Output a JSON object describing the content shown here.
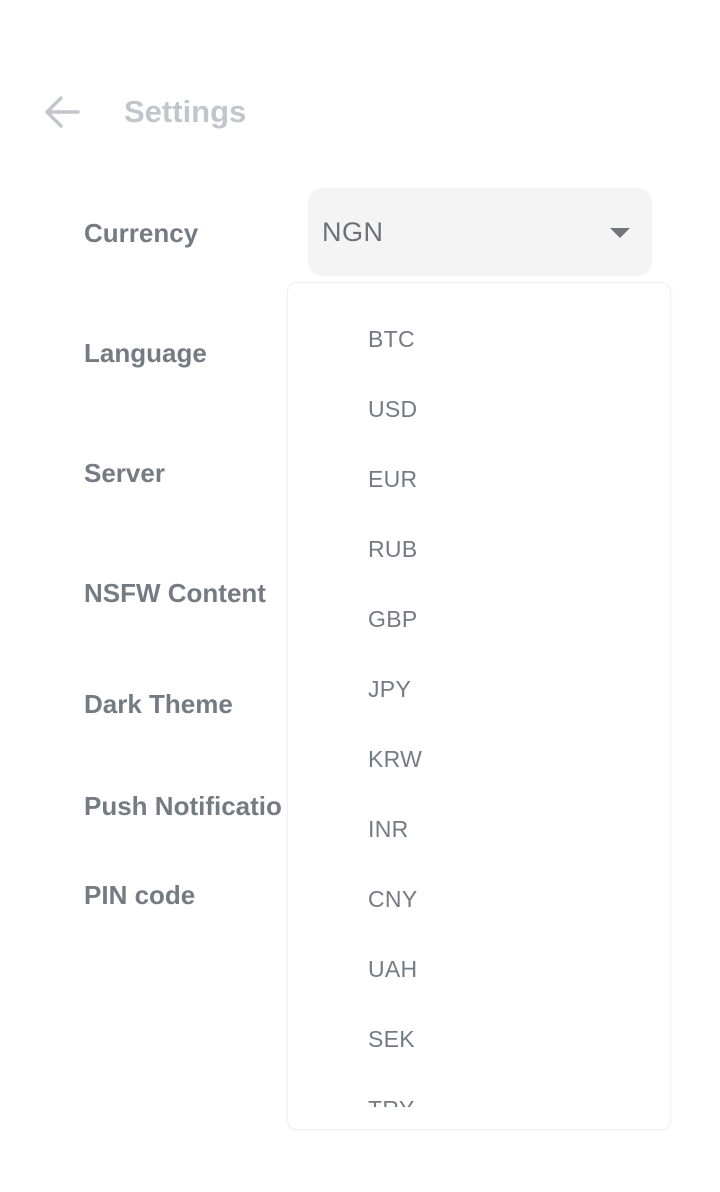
{
  "header": {
    "title": "Settings",
    "back_icon": "arrow-left-icon"
  },
  "settings": {
    "rows": [
      {
        "label": "Currency"
      },
      {
        "label": "Language"
      },
      {
        "label": "Server"
      },
      {
        "label": "NSFW Content"
      },
      {
        "label": "Dark Theme"
      },
      {
        "label": "Push Notificatio"
      },
      {
        "label": "PIN code"
      }
    ]
  },
  "currency_select": {
    "value": "NGN",
    "caret_icon": "caret-down-icon",
    "options": [
      "BTC",
      "USD",
      "EUR",
      "RUB",
      "GBP",
      "JPY",
      "KRW",
      "INR",
      "CNY",
      "UAH",
      "SEK",
      "TRY"
    ]
  },
  "colors": {
    "title": "#c2c6cb",
    "label": "#747b83",
    "select_bg": "#f4f4f4"
  }
}
